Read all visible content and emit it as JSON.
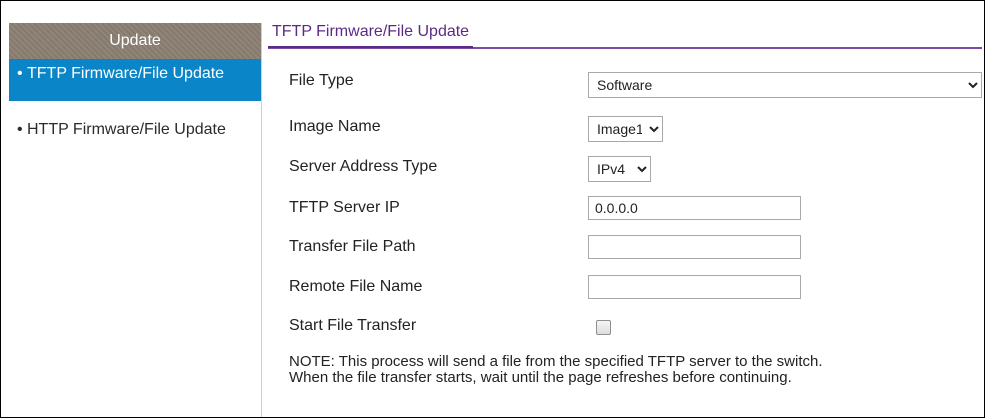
{
  "sidebar": {
    "header": "Update",
    "items": [
      {
        "label": "TFTP Firmware/File Update",
        "active": true
      },
      {
        "label": "HTTP Firmware/File Update",
        "active": false
      }
    ],
    "active_color": "#0a86c8",
    "header_color": "#8a7f71"
  },
  "main": {
    "tab": "TFTP Firmware/File Update",
    "fields": {
      "file_type": {
        "label": "File Type",
        "value": "Software"
      },
      "image_name": {
        "label": "Image Name",
        "value": "Image1"
      },
      "server_address_type": {
        "label": "Server Address Type",
        "value": "IPv4"
      },
      "tftp_server_ip": {
        "label": "TFTP Server IP",
        "value": "0.0.0.0"
      },
      "transfer_file_path": {
        "label": "Transfer File Path",
        "value": ""
      },
      "remote_file_name": {
        "label": "Remote File Name",
        "value": ""
      },
      "start_file_transfer": {
        "label": "Start File Transfer",
        "checked": false
      }
    },
    "note_line1": "NOTE: This process will send a file from the specified TFTP server to the switch.",
    "note_line2": "When the file transfer starts, wait until the page refreshes before continuing."
  }
}
